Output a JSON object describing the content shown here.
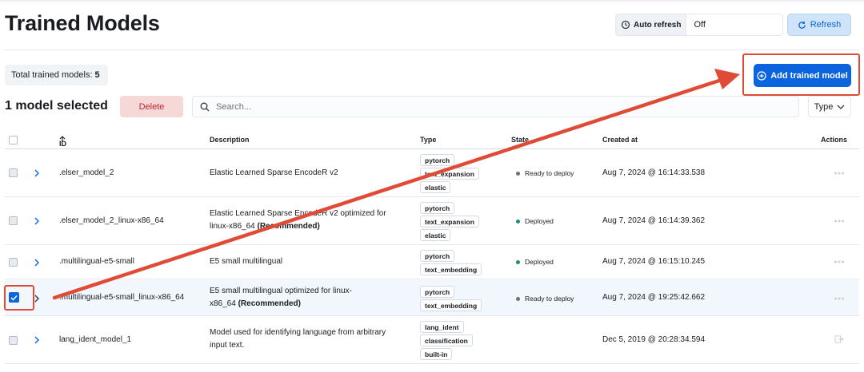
{
  "page": {
    "title": "Trained Models"
  },
  "toolbar": {
    "autorefresh_label": "Auto refresh",
    "autorefresh_value": "Off",
    "refresh_label": "Refresh",
    "add_label": "Add trained model"
  },
  "summary": {
    "total_label": "Total trained models:",
    "total_count": "5"
  },
  "selection": {
    "selected_label": "1 model selected",
    "delete_label": "Delete"
  },
  "search": {
    "placeholder": "Search...",
    "type_filter": "Type"
  },
  "table": {
    "headers": {
      "id": "ID",
      "description": "Description",
      "type": "Type",
      "state": "State",
      "created": "Created at",
      "actions": "Actions"
    },
    "rows": [
      {
        "id": ".elser_model_2",
        "desc1": "Elastic Learned Sparse EncodeR v2",
        "desc2": "",
        "desc_bold": "",
        "types": [
          "pytorch",
          "text_expansion",
          "elastic"
        ],
        "state": "Ready to deploy",
        "created": "Aug 7, 2024 @ 16:14:33.538"
      },
      {
        "id": ".elser_model_2_linux-x86_64",
        "desc1": "Elastic Learned Sparse EncodeR v2 optimized for",
        "desc2": "linux-x86_64",
        "desc_bold": "(Recommended)",
        "types": [
          "pytorch",
          "text_expansion",
          "elastic"
        ],
        "state": "Deployed",
        "created": "Aug 7, 2024 @ 16:14:39.362"
      },
      {
        "id": ".multilingual-e5-small",
        "desc1": "E5 small multilingual",
        "desc2": "",
        "desc_bold": "",
        "types": [
          "pytorch",
          "text_embedding"
        ],
        "state": "Deployed",
        "created": "Aug 7, 2024 @ 16:15:10.245"
      },
      {
        "id": ".multilingual-e5-small_linux-x86_64",
        "desc1": "E5 small multilingual optimized for linux-",
        "desc2": "x86_64",
        "desc_bold": "(Recommended)",
        "types": [
          "pytorch",
          "text_embedding"
        ],
        "state": "Ready to deploy",
        "created": "Aug 7, 2024 @ 19:25:42.662"
      },
      {
        "id": "lang_ident_model_1",
        "desc1": "Model used for identifying language from arbitrary",
        "desc2": "input text.",
        "desc_bold": "",
        "types": [
          "lang_ident",
          "classification",
          "built-in"
        ],
        "state": "",
        "created": "Dec 5, 2019 @ 20:28:34.594"
      }
    ]
  },
  "colors": {
    "primary": "#0b64dd",
    "danger": "#c2262b",
    "deployed": "#1e8b75",
    "annotation": "#e04b35"
  }
}
